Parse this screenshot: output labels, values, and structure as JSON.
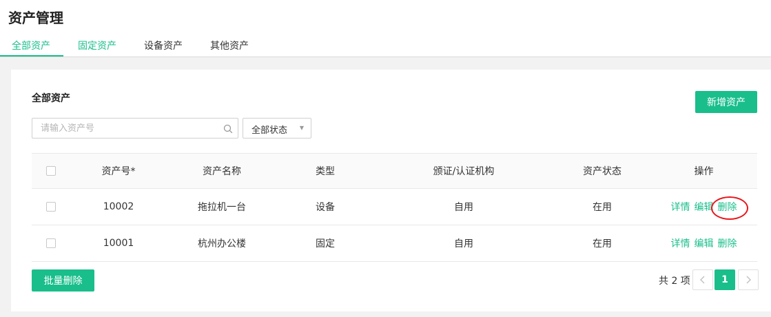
{
  "header": {
    "title": "资产管理"
  },
  "tabs": [
    {
      "label": "全部资产"
    },
    {
      "label": "固定资产"
    },
    {
      "label": "设备资产"
    },
    {
      "label": "其他资产"
    }
  ],
  "section": {
    "title": "全部资产"
  },
  "toolbar": {
    "add_label": "新增资产"
  },
  "search": {
    "placeholder": "请输入资产号"
  },
  "status_filter": {
    "selected": "全部状态"
  },
  "table": {
    "columns": [
      "资产号*",
      "资产名称",
      "类型",
      "颁证/认证机构",
      "资产状态",
      "操作"
    ],
    "rows": [
      {
        "id": "10002",
        "name": "拖拉机一台",
        "type": "设备",
        "authority": "自用",
        "status": "在用"
      },
      {
        "id": "10001",
        "name": "杭州办公楼",
        "type": "固定",
        "authority": "自用",
        "status": "在用"
      }
    ],
    "actions": {
      "detail": "详情",
      "edit": "编辑",
      "delete": "删除"
    }
  },
  "footer": {
    "batch_delete_label": "批量删除"
  },
  "pagination": {
    "total_text": "共 2 项",
    "current_page": "1"
  },
  "colors": {
    "accent": "#19be8b",
    "highlight": "#e8151b"
  }
}
